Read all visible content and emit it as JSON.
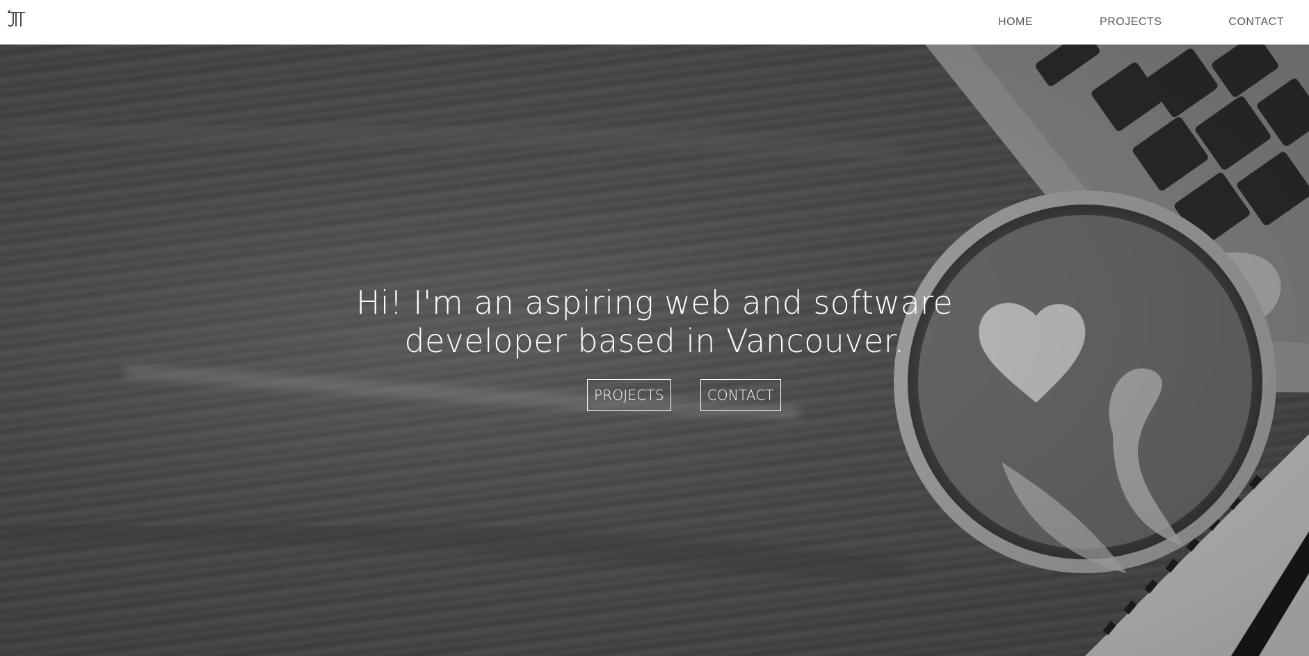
{
  "nav": {
    "logo_name": "jt-monogram-logo",
    "links": [
      {
        "label": "HOME"
      },
      {
        "label": "PROJECTS"
      },
      {
        "label": "CONTACT"
      }
    ]
  },
  "hero": {
    "headline_line1": "Hi! I'm an aspiring web and software",
    "headline_line2": "developer based in Vancouver.",
    "buttons": [
      {
        "label": "PROJECTS"
      },
      {
        "label": "CONTACT"
      }
    ],
    "background": "grayscale desk photo with coffee latte art, laptop keyboard and notebook"
  },
  "colors": {
    "nav_bg": "#ffffff",
    "nav_text": "#555b5e",
    "hero_text": "#ffffff"
  }
}
